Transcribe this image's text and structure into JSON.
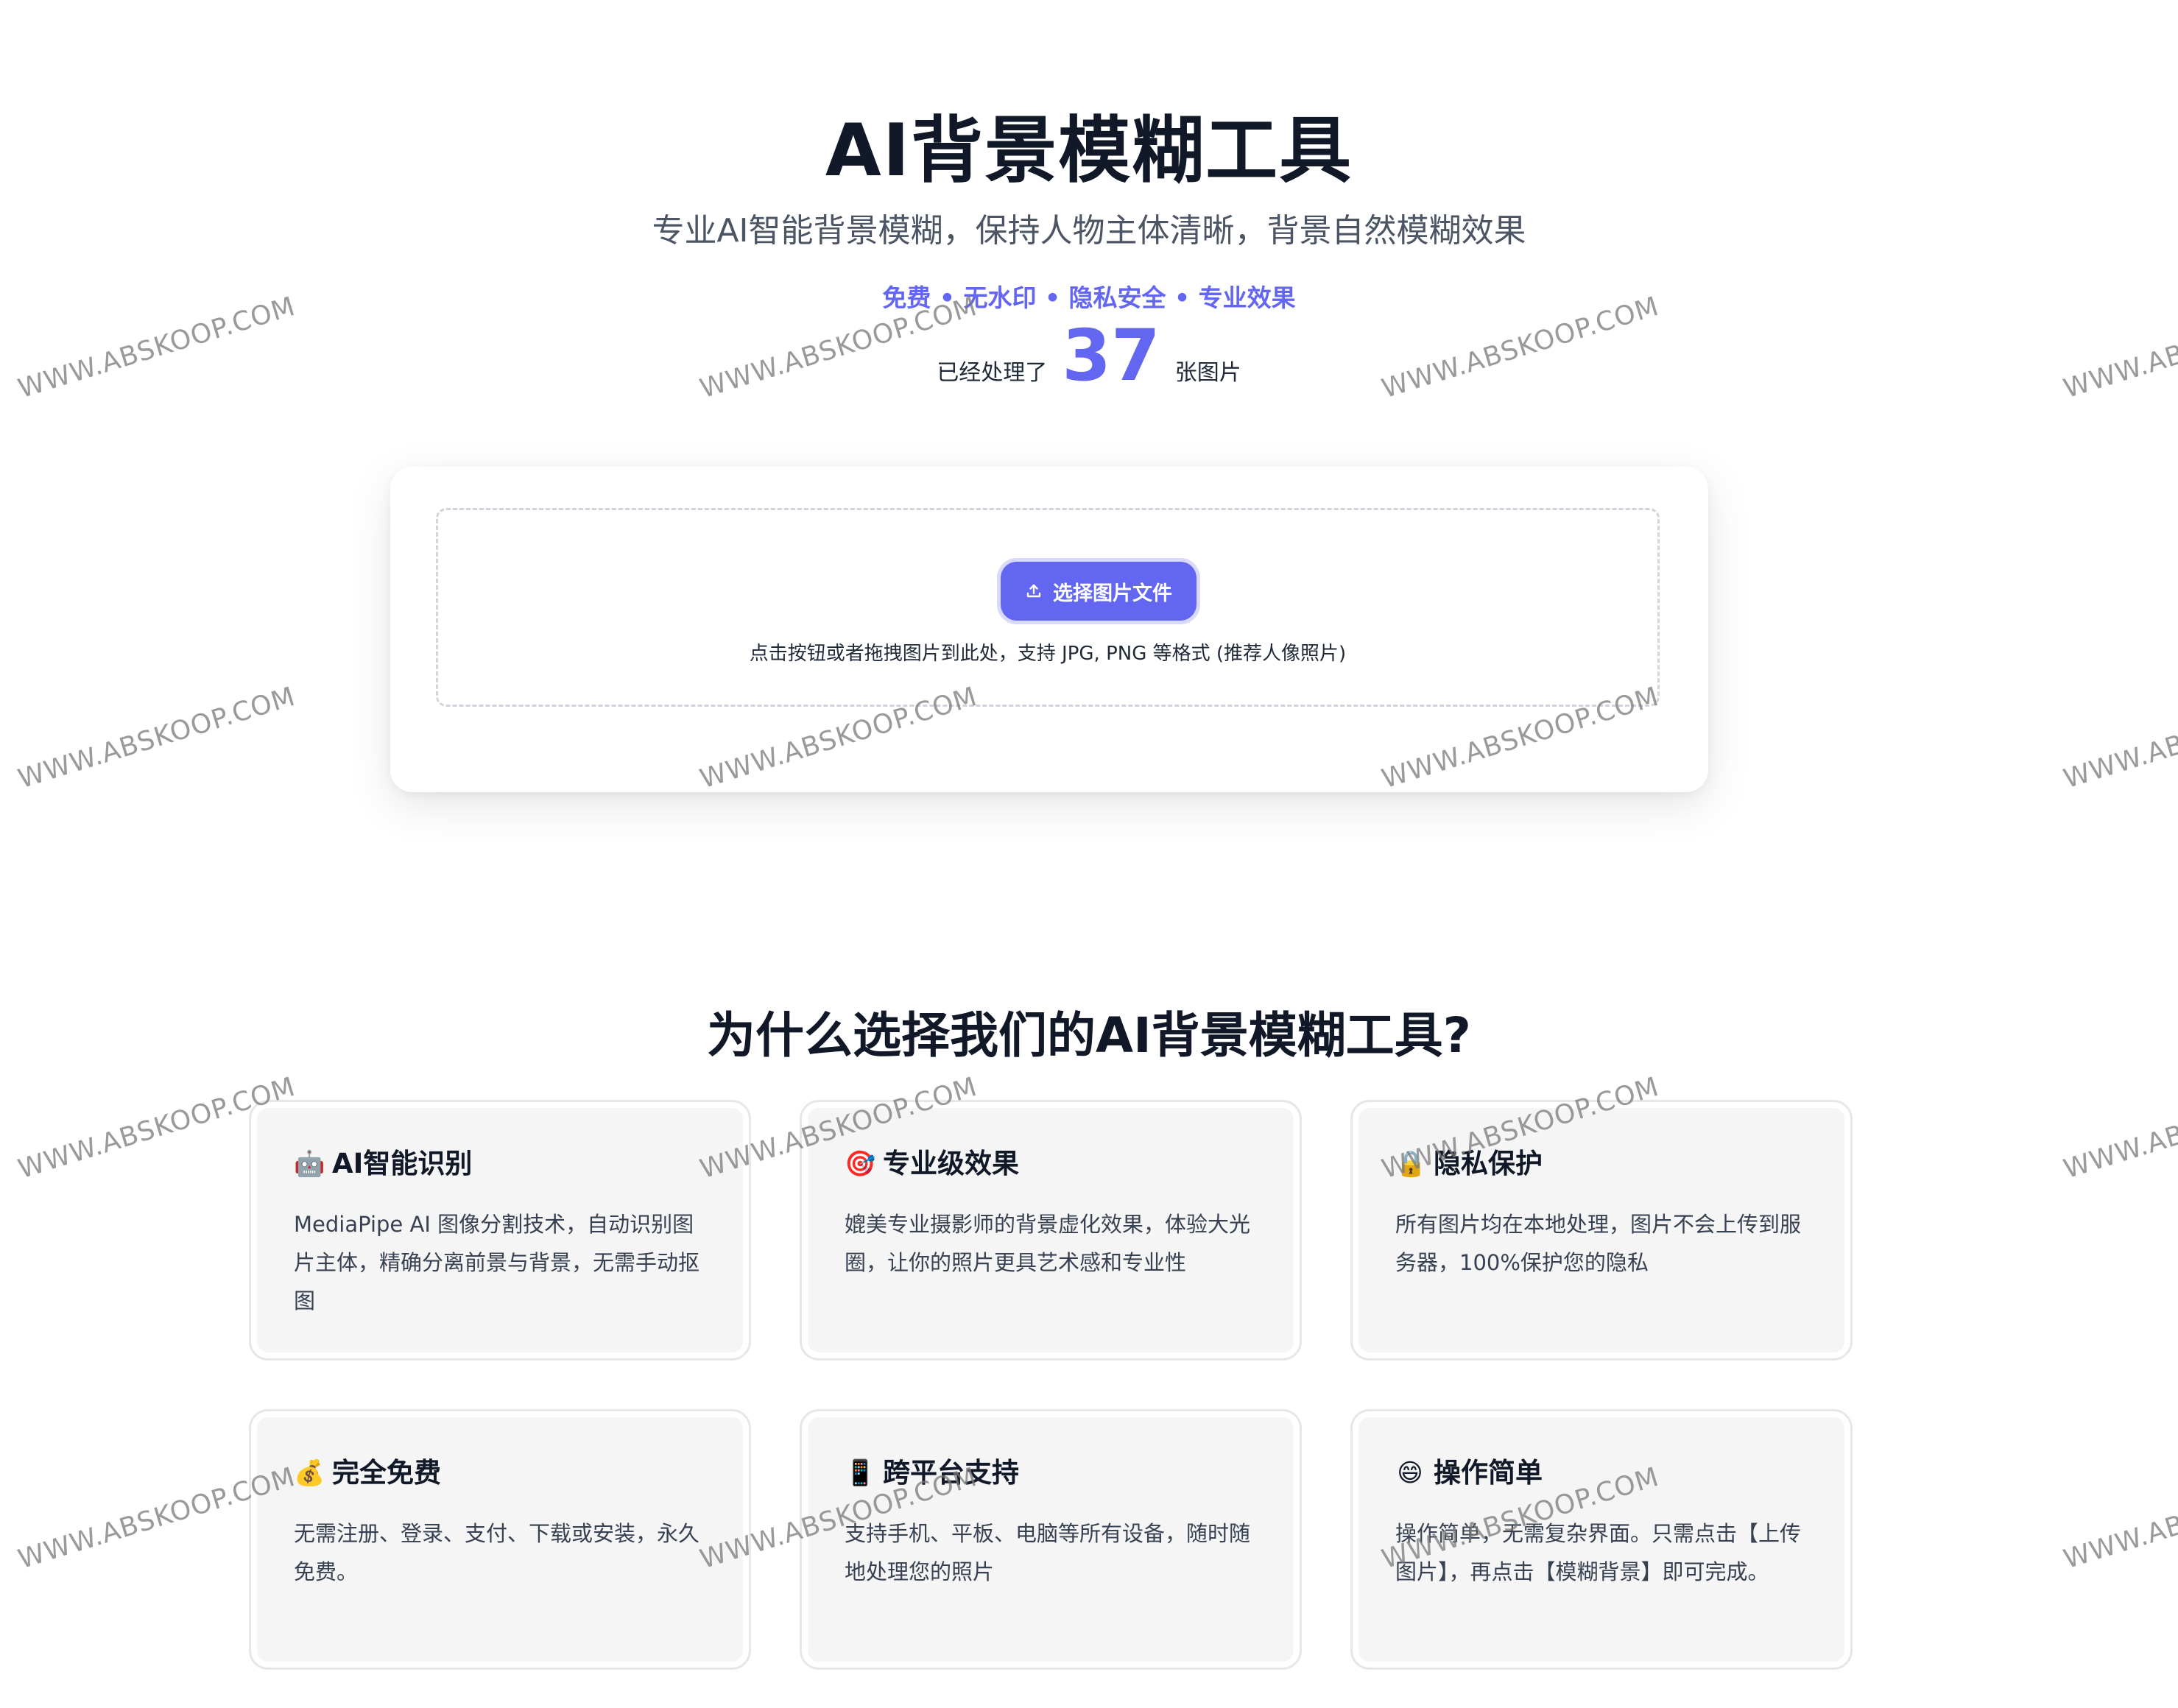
{
  "hero": {
    "title": "AI背景模糊工具",
    "subtitle": "专业AI智能背景模糊，保持人物主体清晰，背景自然模糊效果",
    "tags": "免费 • 无水印 • 隐私安全 • 专业效果",
    "count_prefix": "已经处理了",
    "count_value": "37",
    "count_suffix": "张图片"
  },
  "upload": {
    "button_label": "选择图片文件",
    "button_icon": "upload-icon",
    "hint": "点击按钮或者拖拽图片到此处，支持 JPG, PNG 等格式 (推荐人像照片)"
  },
  "features": {
    "title": "为什么选择我们的AI背景模糊工具?",
    "items": [
      {
        "icon": "🤖",
        "icon_name": "robot-icon",
        "title": "AI智能识别",
        "text": "MediaPipe AI 图像分割技术，自动识别图片主体，精确分离前景与背景，无需手动抠图"
      },
      {
        "icon": "🎯",
        "icon_name": "target-icon",
        "title": "专业级效果",
        "text": "媲美专业摄影师的背景虚化效果，体验大光圈，让你的照片更具艺术感和专业性"
      },
      {
        "icon": "🔒",
        "icon_name": "lock-icon",
        "title": "隐私保护",
        "text": "所有图片均在本地处理，图片不会上传到服务器，100%保护您的隐私"
      },
      {
        "icon": "💰",
        "icon_name": "money-bag-icon",
        "title": "完全免费",
        "text": "无需注册、登录、支付、下载或安装，永久免费。"
      },
      {
        "icon": "📱",
        "icon_name": "mobile-phone-icon",
        "title": "跨平台支持",
        "text": "支持手机、平板、电脑等所有设备，随时随地处理您的照片"
      },
      {
        "icon": "😄",
        "icon_name": "smile-icon",
        "title": "操作简单",
        "text": "操作简单，无需复杂界面。只需点击【上传图片】，再点击【模糊背景】即可完成。"
      }
    ]
  },
  "watermark_text": "WWW.ABSKOOP.COM"
}
